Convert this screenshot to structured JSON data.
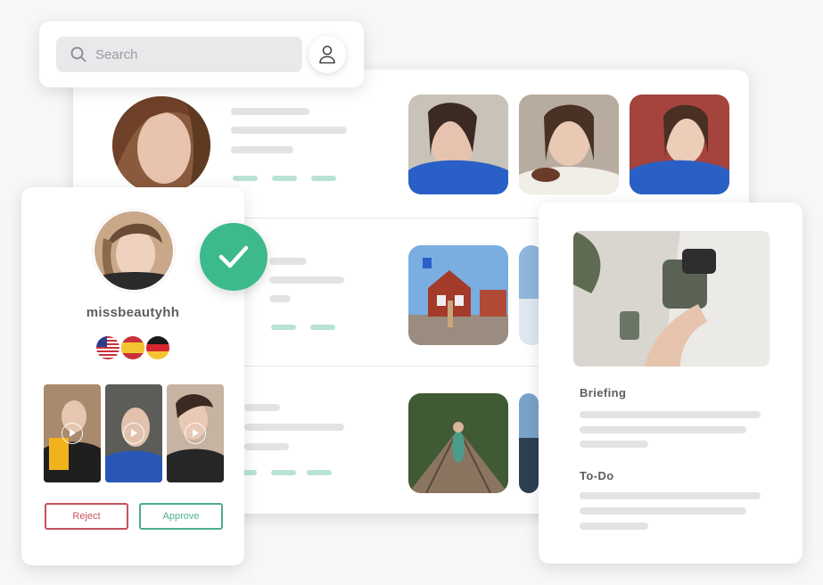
{
  "search": {
    "placeholder": "Search",
    "icon": "search-icon"
  },
  "profile": {
    "icon": "user-icon"
  },
  "creator": {
    "username": "missbeautyhh",
    "languages": [
      "us-flag-icon",
      "spain-flag-icon",
      "germany-flag-icon"
    ],
    "reject_label": "Reject",
    "approve_label": "Approve"
  },
  "briefing": {
    "briefing_title": "Briefing",
    "todo_title": "To-Do"
  },
  "colors": {
    "accent_green": "#3dba8c",
    "reject_red": "#c7515f",
    "approve_green": "#4dae8d",
    "skeleton": "#e3e3e3",
    "dash": "#b9e3d2"
  }
}
